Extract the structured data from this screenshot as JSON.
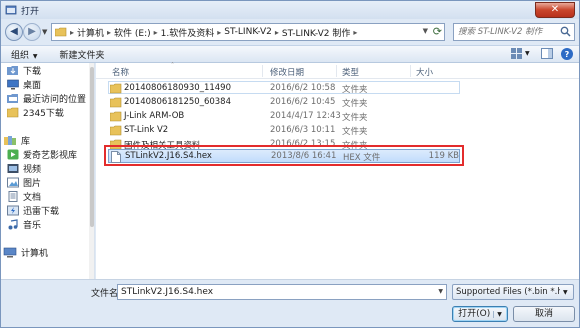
{
  "window": {
    "title": "打开",
    "close_label": "✕"
  },
  "nav_buttons": {
    "back": "◀",
    "forward": "▶"
  },
  "address": {
    "crumbs": [
      "计算机",
      "软件 (E:)",
      "1.软件及资料",
      "ST-LINK-V2",
      "ST-LINK-V2 制作"
    ]
  },
  "search": {
    "placeholder": "搜索 ST-LINK-V2 制作"
  },
  "toolbar": {
    "organize": "组织",
    "new_folder": "新建文件夹"
  },
  "sidebar": {
    "items": [
      {
        "label": "下载",
        "icon": "download-folder-icon"
      },
      {
        "label": "桌面",
        "icon": "desktop-icon"
      },
      {
        "label": "最近访问的位置",
        "icon": "recent-places-icon"
      },
      {
        "label": "2345下载",
        "icon": "folder-icon"
      }
    ],
    "libraries_label": "库",
    "libraries": [
      {
        "label": "爱奇艺影视库",
        "icon": "video-library-icon"
      },
      {
        "label": "视频",
        "icon": "video-icon"
      },
      {
        "label": "图片",
        "icon": "pictures-icon"
      },
      {
        "label": "文档",
        "icon": "documents-icon"
      },
      {
        "label": "迅雷下载",
        "icon": "thunder-download-icon"
      },
      {
        "label": "音乐",
        "icon": "music-icon"
      }
    ],
    "computer_label": "计算机"
  },
  "columns": {
    "name": "名称",
    "date": "修改日期",
    "type": "类型",
    "size": "大小"
  },
  "files": [
    {
      "name": "20140806180930_11490",
      "date": "2016/6/2 10:58",
      "type": "文件夹",
      "size": "",
      "kind": "folder"
    },
    {
      "name": "20140806181250_60384",
      "date": "2016/6/2 10:45",
      "type": "文件夹",
      "size": "",
      "kind": "folder"
    },
    {
      "name": "J-Link ARM-OB",
      "date": "2014/4/17 12:43",
      "type": "文件夹",
      "size": "",
      "kind": "folder"
    },
    {
      "name": "ST-Link V2",
      "date": "2016/6/3 10:11",
      "type": "文件夹",
      "size": "",
      "kind": "folder"
    },
    {
      "name": "固件及相关工具资料",
      "date": "2016/6/2 13:15",
      "type": "文件夹",
      "size": "",
      "kind": "folder"
    },
    {
      "name": "STLinkV2.J16.S4.hex",
      "date": "2013/8/6 16:41",
      "type": "HEX 文件",
      "size": "119 KB",
      "kind": "file"
    }
  ],
  "footer": {
    "filename_label": "文件名(N):",
    "filename_value": "STLinkV2.J16.S4.hex",
    "filter_value": "Supported Files (*.bin *.hex *",
    "open_label": "打开(O)",
    "cancel_label": "取消"
  },
  "colors": {
    "highlight_box": "#e32c2c",
    "folder": "#e8c25a",
    "accent": "#2d6bc5"
  }
}
